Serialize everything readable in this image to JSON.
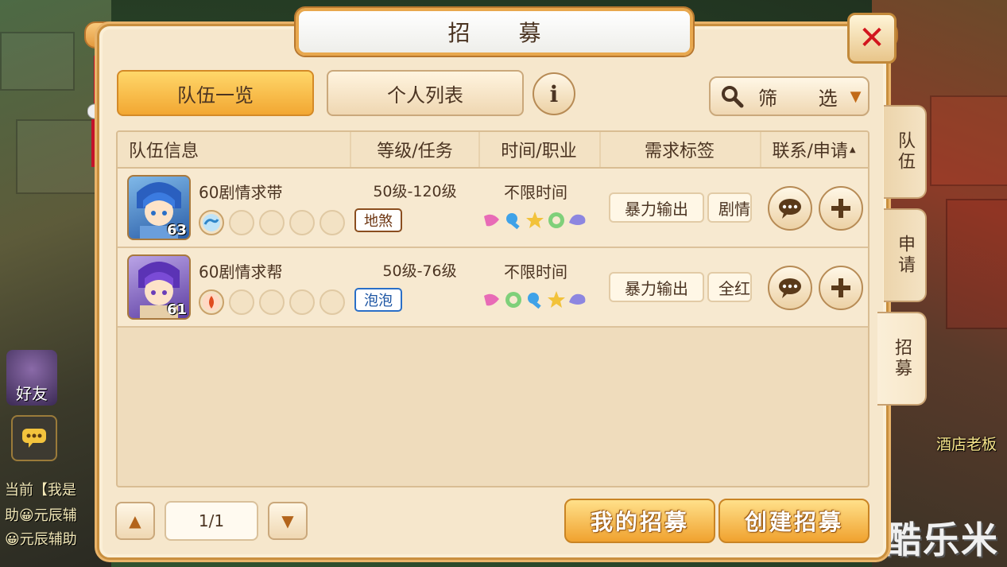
{
  "window": {
    "title": "招 募",
    "close_label": "✕"
  },
  "tabs": [
    {
      "label": "队伍一览",
      "active": true
    },
    {
      "label": "个人列表",
      "active": false
    }
  ],
  "filter": {
    "label": "筛 选"
  },
  "table": {
    "headers": [
      "队伍信息",
      "等级/任务",
      "时间/职业",
      "需求标签",
      "联系/申请"
    ],
    "rows": [
      {
        "name": "60剧情求带",
        "level": "63",
        "level_range": "50级-120级",
        "task_tag": "地煞",
        "task_tag_color": "brown",
        "time": "不限时间",
        "member_school": "water",
        "need_tags": [
          "暴力输出",
          "剧情"
        ]
      },
      {
        "name": "60剧情求帮",
        "level": "61",
        "level_range": "50级-76级",
        "task_tag": "泡泡",
        "task_tag_color": "blue",
        "time": "不限时间",
        "member_school": "fire",
        "need_tags": [
          "暴力输出",
          "全红"
        ]
      }
    ]
  },
  "side_tabs": [
    "队伍",
    "申请",
    "招募"
  ],
  "pagination": {
    "value": "1/1"
  },
  "footer_buttons": {
    "my_recruit": "我的招募",
    "create_recruit": "创建招募"
  },
  "background": {
    "friend_label": "好友",
    "chat_lines": [
      "当前【我是",
      "助😀元辰辅",
      "😀元辰辅助"
    ],
    "npc_label": "酒店老板",
    "watermark": "酷乐米"
  },
  "colors": {
    "accent": "#f2a732",
    "panel": "#f6e7cc",
    "close": "#d2151d"
  }
}
